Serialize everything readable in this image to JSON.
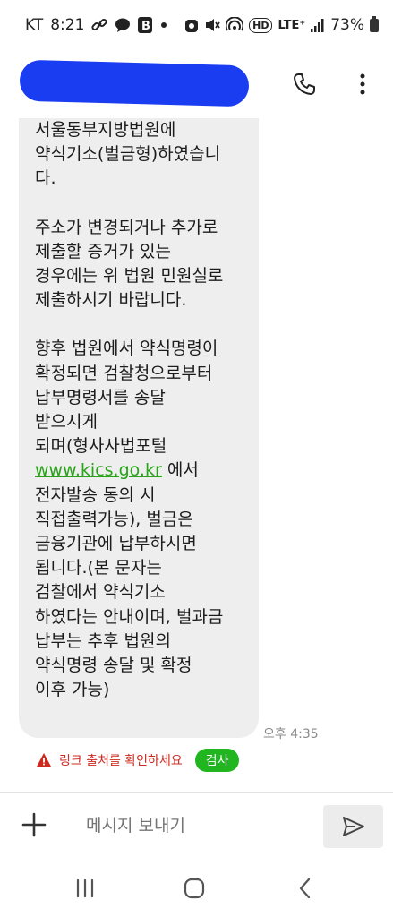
{
  "status_bar": {
    "carrier": "KT",
    "time": "8:21",
    "hd_label": "HD",
    "network": "LTE⁺",
    "battery": "73%"
  },
  "header": {
    "contact_name_redacted_color": "#1a3df2"
  },
  "message": {
    "lines_p1": [
      "서울동부지방법원에",
      "약식기소(벌금형)하였습니",
      "다."
    ],
    "lines_p2": [
      "주소가 변경되거나 추가로",
      "제출할 증거가 있는",
      "경우에는 위 법원 민원실로",
      "제출하시기 바랍니다."
    ],
    "lines_p3_before": [
      "향후 법원에서 약식명령이",
      "확정되면 검찰청으로부터",
      "납부명령서를 송달",
      "받으시게",
      "되며(형사사법포털"
    ],
    "link_text": "www.kics.go.kr",
    "link_suffix": " 에서",
    "lines_p3_after": [
      "전자발송 동의 시",
      "직접출력가능), 벌금은",
      "금융기관에 납부하시면",
      "됩니다.(본 문자는",
      "검찰에서 약식기소",
      "하였다는 안내이며, 벌과금",
      "납부는 추후 법원의",
      "약식명령 송달 및 확정",
      "이후 가능)"
    ],
    "time": "오후 4:35"
  },
  "warning": {
    "text": "링크 출처를 확인하세요",
    "check_label": "검사"
  },
  "composer": {
    "placeholder": "메시지 보내기"
  },
  "colors": {
    "bubble": "#eeeeee",
    "link": "#2aa31b",
    "warning": "#cc2a1f",
    "check_button": "#21b51f"
  }
}
